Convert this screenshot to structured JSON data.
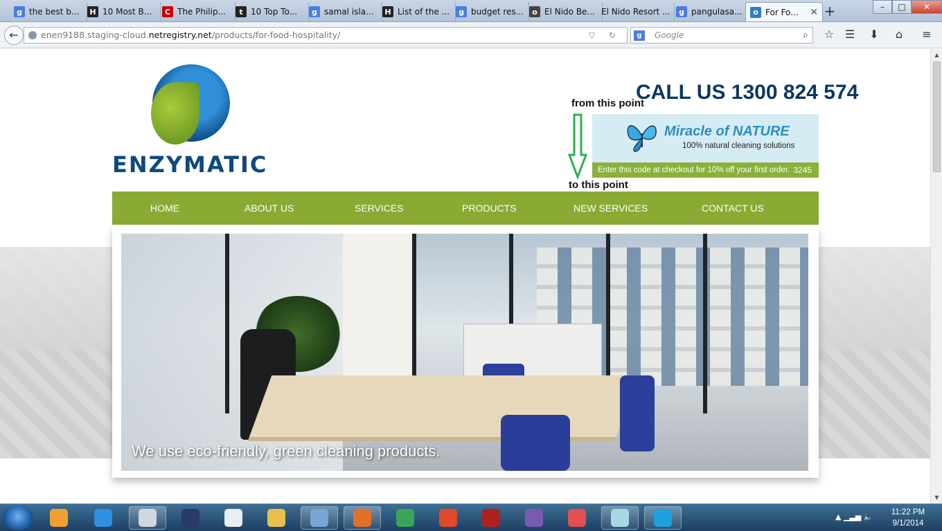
{
  "browser": {
    "tabs": [
      {
        "title": "the best b...",
        "favicon": "google-icon",
        "color": "#4a7de0",
        "glyph": "g"
      },
      {
        "title": "10 Most B...",
        "favicon": "h-icon",
        "color": "#222222",
        "glyph": "H"
      },
      {
        "title": "The Philip...",
        "favicon": "cnn-icon",
        "color": "#cc0000",
        "glyph": "C"
      },
      {
        "title": "10 Top To...",
        "favicon": "t-icon",
        "color": "#222222",
        "glyph": "t"
      },
      {
        "title": "samal isla...",
        "favicon": "google-icon",
        "color": "#4a7de0",
        "glyph": "g"
      },
      {
        "title": "List of the ...",
        "favicon": "h-icon",
        "color": "#222222",
        "glyph": "H"
      },
      {
        "title": "budget res...",
        "favicon": "google-icon",
        "color": "#4a7de0",
        "glyph": "g"
      },
      {
        "title": "El Nido Be...",
        "favicon": "tripadvisor-icon",
        "color": "#444444",
        "glyph": "o"
      },
      {
        "title": "El Nido Resort ...",
        "favicon": "",
        "color": "",
        "glyph": ""
      },
      {
        "title": "pangulasa...",
        "favicon": "google-icon",
        "color": "#4a7de0",
        "glyph": "g"
      },
      {
        "title": "For Fo...",
        "favicon": "globe-icon",
        "color": "#2f7fbf",
        "glyph": "o",
        "active": true
      }
    ],
    "new_tab_label": "+",
    "window_controls": {
      "minimize": "–",
      "maximize": "□",
      "close": "✕"
    },
    "url": {
      "prefix": "enen9188.staging-cloud.",
      "domain": "netregistry.net",
      "path": "/products/for-food-hospitality/"
    },
    "url_tools": "▽ ↻",
    "search_placeholder": "Google",
    "search_engine_glyph": "g",
    "search_icon": "⌕",
    "nav_icons": [
      {
        "name": "bookmark-star-icon",
        "glyph": "☆"
      },
      {
        "name": "bookmarks-list-icon",
        "glyph": "☰"
      },
      {
        "name": "downloads-icon",
        "glyph": "⬇"
      },
      {
        "name": "home-icon",
        "glyph": "⌂"
      },
      {
        "name": "menu-icon",
        "glyph": "≡"
      }
    ],
    "back_icon": "←"
  },
  "page": {
    "logo_text": "ENZYMATIC",
    "call_us": "CALL US 1300 824 574",
    "annotation_from": "from this point",
    "annotation_to": "to this point",
    "banner": {
      "title": "Miracle of NATURE",
      "subtitle": "100% natural cleaning solutions",
      "promo": "Enter this code at checkout for 10% off your first order.",
      "code": "3245"
    },
    "nav": [
      "Home",
      "About Us",
      "Services",
      "Products",
      "New Services",
      "Contact Us"
    ],
    "hero_caption": "We use eco-friendly, green cleaning products."
  },
  "taskbar": {
    "apps": [
      {
        "name": "media-player-icon",
        "color": "#f0a030",
        "open": false
      },
      {
        "name": "internet-explorer-icon",
        "color": "#2f8fe0",
        "open": false
      },
      {
        "name": "scanner-icon",
        "color": "#cfd7df",
        "open": true
      },
      {
        "name": "pen-app-icon",
        "color": "#2a3a6a",
        "open": false
      },
      {
        "name": "document-icon",
        "color": "#e8eef4",
        "open": false
      },
      {
        "name": "file-explorer-icon",
        "color": "#e8c050",
        "open": false
      },
      {
        "name": "torrent-icon",
        "color": "#7aa6d6",
        "open": true
      },
      {
        "name": "firefox-icon",
        "color": "#e0702a",
        "open": true
      },
      {
        "name": "chrome-icon",
        "color": "#3aa55a",
        "open": false
      },
      {
        "name": "todo-icon",
        "color": "#e04a2a",
        "open": false
      },
      {
        "name": "ladybug-app-icon",
        "color": "#b02020",
        "open": false
      },
      {
        "name": "viber-icon",
        "color": "#7a5ab0",
        "open": false
      },
      {
        "name": "snipping-tool-icon",
        "color": "#e05050",
        "open": false
      },
      {
        "name": "notes-icon",
        "color": "#a8d8e8",
        "open": true
      },
      {
        "name": "skype-icon",
        "color": "#1fa0e0",
        "open": true
      }
    ],
    "tray": "▲  ▁▃▅  🔈",
    "time": "11:22 PM",
    "date": "9/1/2014"
  }
}
